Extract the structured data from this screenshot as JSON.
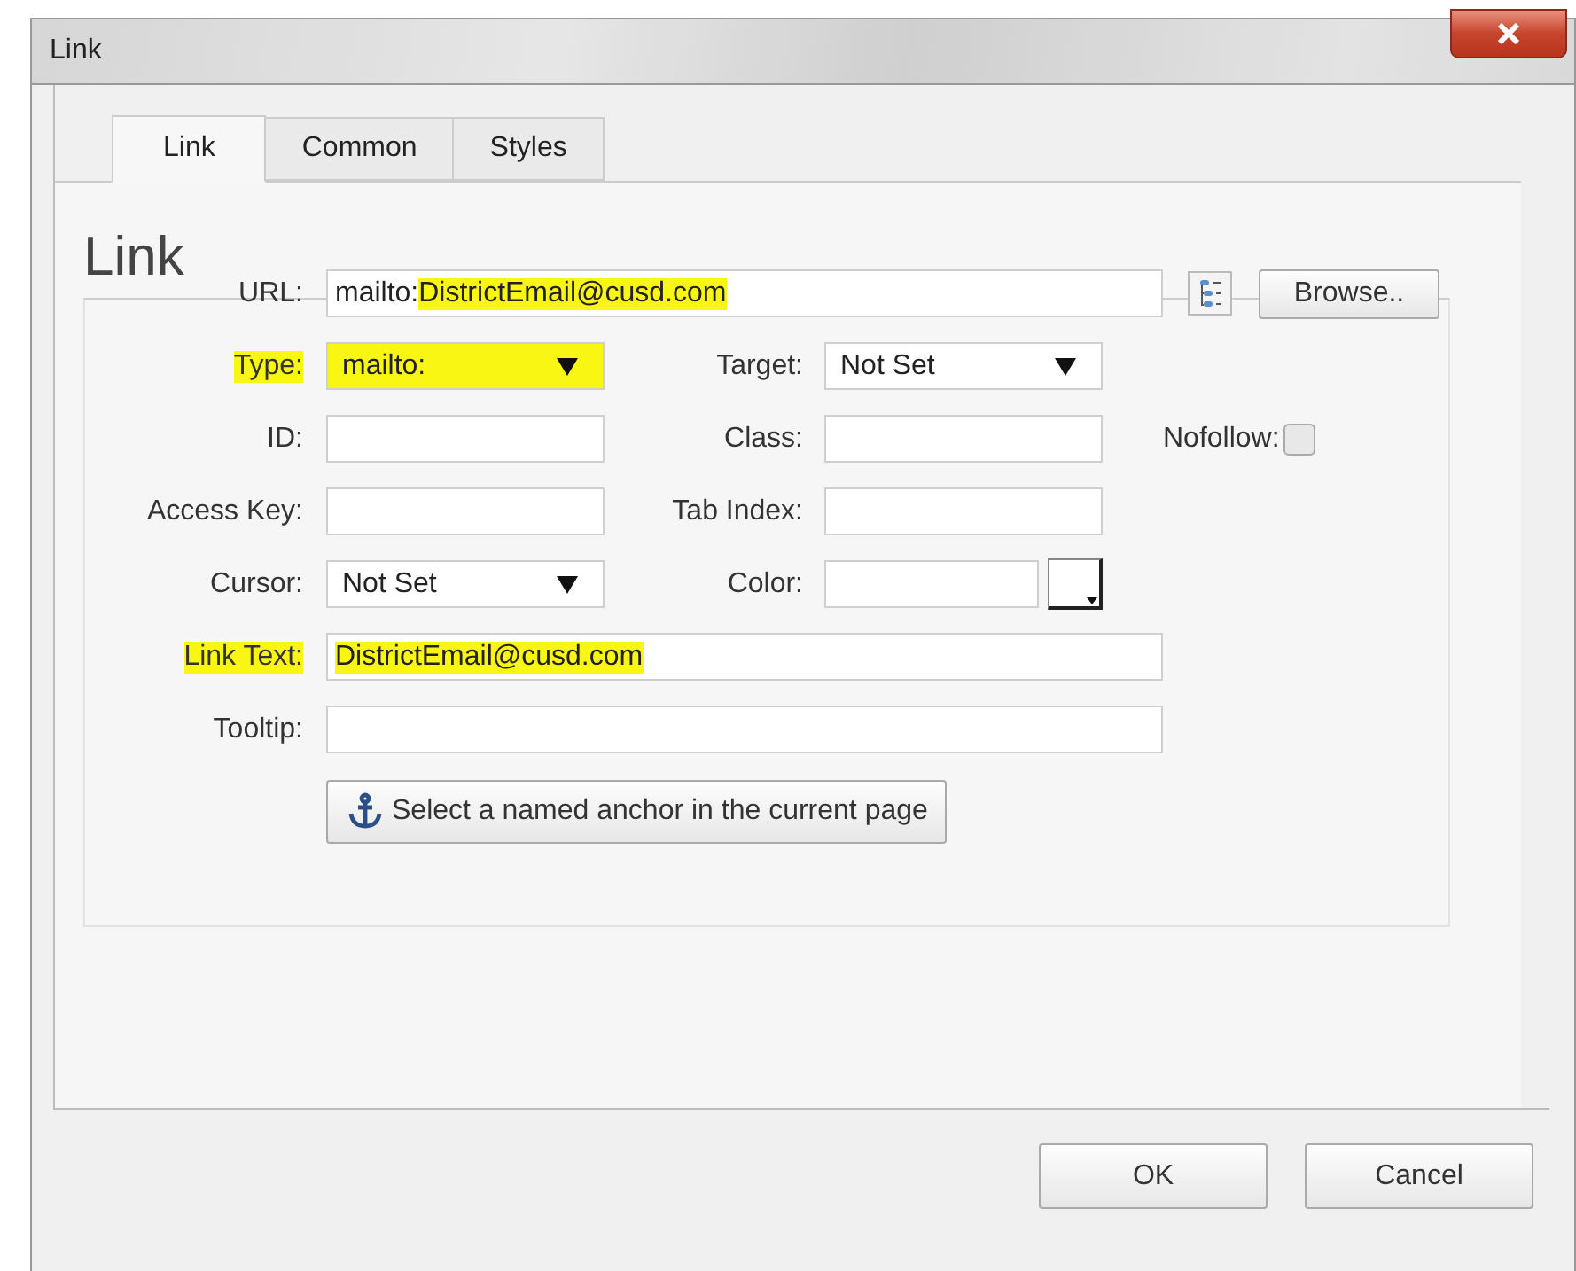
{
  "window": {
    "title": "Link"
  },
  "tabs": [
    {
      "label": "Link",
      "selected": true
    },
    {
      "label": "Common",
      "selected": false
    },
    {
      "label": "Styles",
      "selected": false
    }
  ],
  "section": {
    "legend": "Link"
  },
  "rows": [
    {
      "fields": [
        {
          "kind": "wide-text",
          "label": "URL:",
          "label_highlighted": false,
          "prefix": "mailto:",
          "value": "DistrictEmail@cusd.com",
          "value_highlighted": true
        }
      ],
      "browse_button": "Browse.."
    },
    {
      "fields": [
        {
          "kind": "select",
          "label": "Type:",
          "label_highlighted": true,
          "value": "mailto:",
          "value_highlighted": true
        },
        {
          "kind": "select",
          "label": "Target:",
          "label_highlighted": false,
          "value": "Not Set",
          "value_highlighted": false
        }
      ]
    },
    {
      "fields": [
        {
          "kind": "text",
          "label": "ID:",
          "label_highlighted": false
        },
        {
          "kind": "text",
          "label": "Class:",
          "label_highlighted": false
        },
        {
          "kind": "checkbox",
          "label": "Nofollow:",
          "checked": false
        }
      ]
    },
    {
      "fields": [
        {
          "kind": "text",
          "label": "Access Key:",
          "label_highlighted": false
        },
        {
          "kind": "text",
          "label": "Tab Index:",
          "label_highlighted": false
        }
      ]
    },
    {
      "fields": [
        {
          "kind": "select",
          "label": "Cursor:",
          "label_highlighted": false,
          "value": "Not Set",
          "value_highlighted": false
        },
        {
          "kind": "color",
          "label": "Color:",
          "label_highlighted": false
        }
      ]
    },
    {
      "fields": [
        {
          "kind": "wide-text",
          "label": "Link Text:",
          "label_highlighted": true,
          "value": "DistrictEmail@cusd.com",
          "value_highlighted": true
        }
      ]
    },
    {
      "fields": [
        {
          "kind": "wide-text",
          "label": "Tooltip:",
          "label_highlighted": false
        }
      ]
    }
  ],
  "anchor_button": "Select a named anchor in the current page",
  "buttons": [
    "OK",
    "Cancel"
  ]
}
